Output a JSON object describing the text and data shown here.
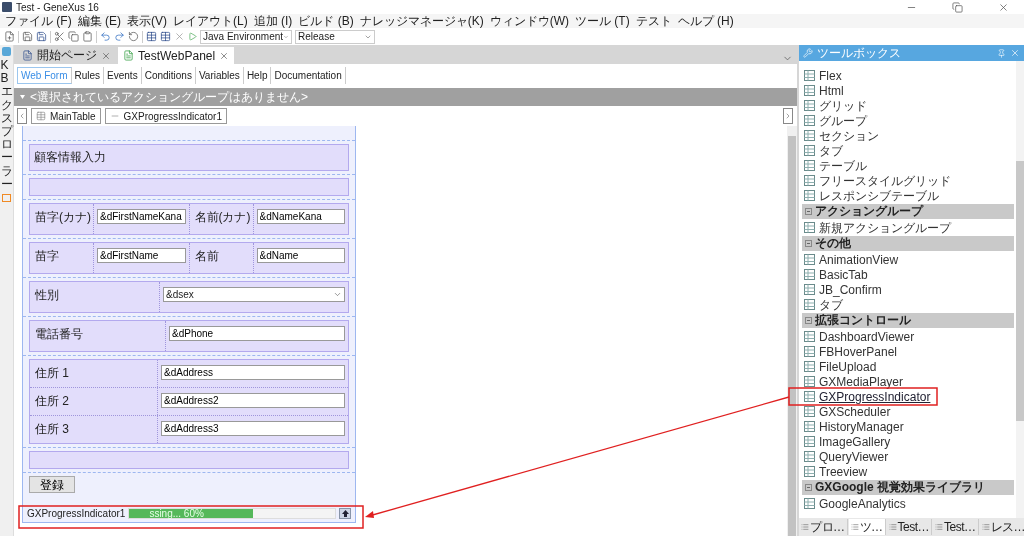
{
  "window": {
    "title": "Test - GeneXus 16"
  },
  "menu": [
    "ファイル (F)",
    "編集 (E)",
    "表示(V)",
    "レイアウト(L)",
    "追加 (I)",
    "ビルド (B)",
    "ナレッジマネージャ(K)",
    "ウィンドウ(W)",
    "ツール (T)",
    "テスト",
    "ヘルプ (H)"
  ],
  "toolbar": {
    "environment": "Java Environment",
    "configuration": "Release"
  },
  "side_tab": {
    "label": "KB エクスプローラー"
  },
  "document_tabs": [
    {
      "label": "開始ページ",
      "selected": false
    },
    {
      "label": "TestWebPanel",
      "selected": true
    }
  ],
  "editor_tabs": [
    {
      "label": "Web Form",
      "selected": true
    },
    {
      "label": "Rules",
      "selected": false
    },
    {
      "label": "Events",
      "selected": false
    },
    {
      "label": "Conditions",
      "selected": false
    },
    {
      "label": "Variables",
      "selected": false
    },
    {
      "label": "Help",
      "selected": false
    },
    {
      "label": "Documentation",
      "selected": false
    }
  ],
  "action_group_bar": "<選択されているアクショングループはありません>",
  "breadcrumb": [
    "MainTable",
    "GXProgressIndicator1"
  ],
  "form": {
    "rows": [
      {
        "kind": "header",
        "text": "顧客情報入力"
      },
      {
        "kind": "blank"
      },
      {
        "kind": "fields",
        "fields": [
          {
            "kind": "text",
            "label": "苗字(カナ)",
            "value": "&dFirstNameKana"
          },
          {
            "kind": "text",
            "label": "名前(カナ)",
            "value": "&dNameKana"
          }
        ]
      },
      {
        "kind": "fields",
        "fields": [
          {
            "kind": "text",
            "label": "苗字",
            "value": "&dFirstName"
          },
          {
            "kind": "text",
            "label": "名前",
            "value": "&dName"
          }
        ]
      },
      {
        "kind": "fields",
        "fields": [
          {
            "kind": "select",
            "label": "性別",
            "value": "&dsex"
          }
        ]
      },
      {
        "kind": "fields",
        "fields": [
          {
            "kind": "text",
            "label": "電話番号",
            "value": "&dPhone"
          }
        ]
      },
      {
        "kind": "stack",
        "fields": [
          {
            "kind": "text",
            "label": "住所 1",
            "value": "&dAddress"
          },
          {
            "kind": "text",
            "label": "住所 2",
            "value": "&dAddress2"
          },
          {
            "kind": "text",
            "label": "住所 3",
            "value": "&dAddress3"
          }
        ]
      },
      {
        "kind": "blank"
      },
      {
        "kind": "button",
        "text": "登録"
      },
      {
        "kind": "progress",
        "label": "GXProgressIndicator1",
        "text": "ssing... 60%",
        "level": 0.6
      }
    ]
  },
  "toolbox": {
    "title": "ツールボックス",
    "groups": [
      {
        "items": [
          {
            "label": "Flex",
            "selected": false
          },
          {
            "label": "Html",
            "selected": false
          },
          {
            "label": "グリッド",
            "selected": false
          },
          {
            "label": "グループ",
            "selected": false
          },
          {
            "label": "セクション",
            "selected": false
          },
          {
            "label": "タブ",
            "selected": false
          },
          {
            "label": "テーブル",
            "selected": false
          },
          {
            "label": "フリースタイルグリッド",
            "selected": false
          },
          {
            "label": "レスポンシブテーブル",
            "selected": false
          }
        ]
      },
      {
        "title": "アクショングループ",
        "expanded": true,
        "items": [
          {
            "label": "新規アクショングループ",
            "selected": false
          }
        ]
      },
      {
        "title": "その他",
        "expanded": true,
        "items": [
          {
            "label": "AnimationView",
            "selected": false
          },
          {
            "label": "BasicTab",
            "selected": false
          },
          {
            "label": "JB_Confirm",
            "selected": false
          },
          {
            "label": "タブ",
            "selected": false
          }
        ]
      },
      {
        "title": "拡張コントロール",
        "expanded": true,
        "items": [
          {
            "label": "DashboardViewer",
            "selected": false
          },
          {
            "label": "FBHoverPanel",
            "selected": false
          },
          {
            "label": "FileUpload",
            "selected": false
          },
          {
            "label": "GXMediaPlayer",
            "selected": false
          },
          {
            "label": "GXProgressIndicator",
            "selected": true
          },
          {
            "label": "GXScheduler",
            "selected": false
          },
          {
            "label": "HistoryManager",
            "selected": false
          },
          {
            "label": "ImageGallery",
            "selected": false
          },
          {
            "label": "QueryViewer",
            "selected": false
          },
          {
            "label": "Treeview",
            "selected": false
          }
        ]
      },
      {
        "title": "GXGoogle 視覚効果ライブラリ",
        "expanded": true,
        "items": [
          {
            "label": "GoogleAnalytics",
            "selected": false
          }
        ]
      }
    ],
    "bottom_tabs": [
      {
        "label": "プロ…",
        "selected": false
      },
      {
        "label": "ツ…",
        "selected": true
      },
      {
        "label": "Test…",
        "selected": false
      },
      {
        "label": "Test…",
        "selected": false
      },
      {
        "label": "レス…",
        "selected": false
      }
    ]
  }
}
